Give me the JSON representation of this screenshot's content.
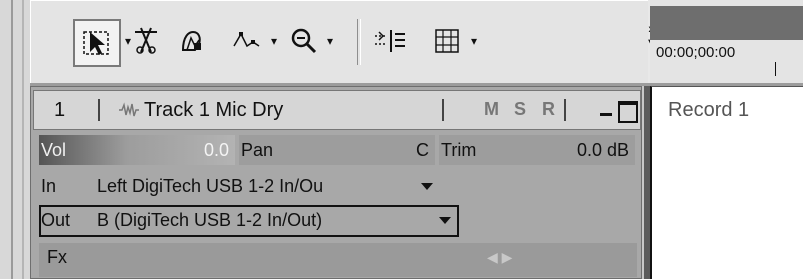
{
  "toolbar": {
    "tools": [
      {
        "name": "normal-edit-tool",
        "icon": "pointer-icon",
        "selected": true
      },
      {
        "name": "split-tool",
        "icon": "scissors-icon"
      },
      {
        "name": "envelope-tool",
        "icon": "envelope-icon"
      },
      {
        "name": "draw-tool",
        "icon": "draw-envelope-icon"
      },
      {
        "name": "zoom-tool",
        "icon": "zoom-icon"
      },
      {
        "name": "snap-tool",
        "icon": "snap-icon"
      },
      {
        "name": "grid-tool",
        "icon": "grid-icon"
      }
    ],
    "overflow_glyph": "»"
  },
  "timeline": {
    "timecode": "00:00;00:00"
  },
  "track": {
    "number": "1",
    "name": "Track 1 Mic Dry",
    "buttons": {
      "mute": "M",
      "solo": "S",
      "record": "R"
    },
    "vol": {
      "label": "Vol",
      "value": "0.0"
    },
    "pan": {
      "label": "Pan",
      "value": "C"
    },
    "trim": {
      "label": "Trim",
      "value": "0.0 dB"
    },
    "input": {
      "label": "In",
      "value": "Left DigiTech USB 1-2 In/Ou"
    },
    "output": {
      "label": "Out",
      "value": "B (DigiTech USB 1-2 In/Out)"
    },
    "fx": {
      "label": "Fx"
    }
  },
  "region": {
    "label": "Record 1"
  }
}
